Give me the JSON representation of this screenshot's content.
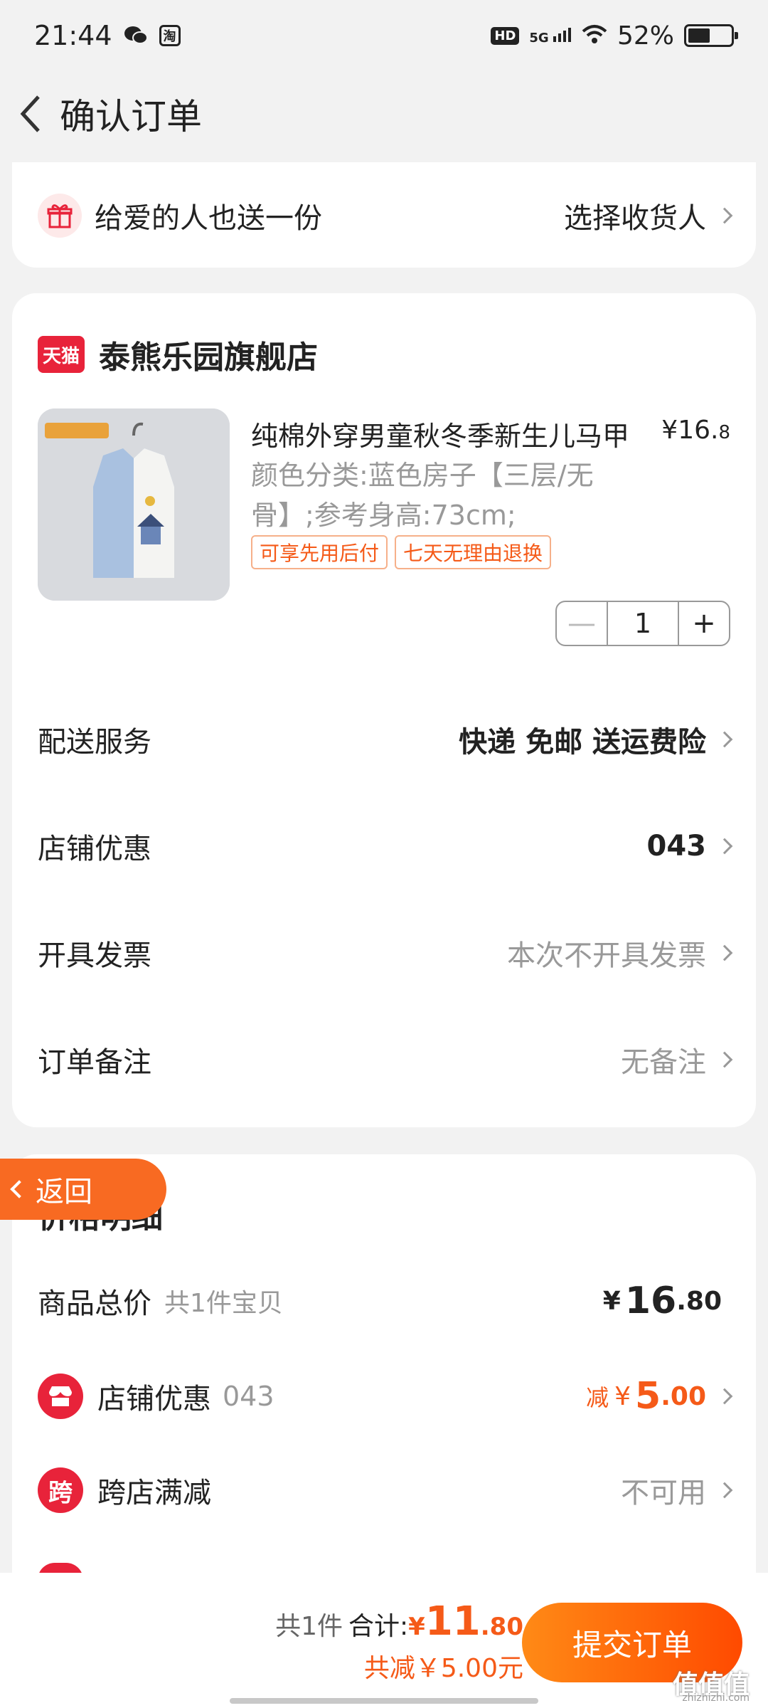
{
  "status": {
    "time": "21:44",
    "battery": "52%",
    "network": "5G",
    "hd": "HD",
    "tao": "淘"
  },
  "header": {
    "title": "确认订单"
  },
  "gift": {
    "label": "给爱的人也送一份",
    "action": "选择收货人"
  },
  "shop": {
    "logo": "天猫",
    "name": "泰熊乐园旗舰店",
    "product": {
      "title": "纯棉外穿男童秋冬季新生儿马甲",
      "price_prefix": "¥16.",
      "price_suffix": "8",
      "sku": "颜色分类:蓝色房子【三层/无骨】;参考身高:73cm;",
      "tags": [
        "可享先用后付",
        "七天无理由退换"
      ],
      "quantity": "1"
    },
    "rows": {
      "delivery": {
        "label": "配送服务",
        "value": "快递 免邮 送运费险"
      },
      "discount": {
        "label": "店铺优惠",
        "value": "043"
      },
      "invoice": {
        "label": "开具发票",
        "value": "本次不开具发票"
      },
      "note": {
        "label": "订单备注",
        "value": "无备注"
      }
    }
  },
  "back_ribbon": {
    "label": "返回"
  },
  "price_detail": {
    "title": "价格明细",
    "total": {
      "label": "商品总价",
      "sub": "共1件宝贝",
      "currency": "¥",
      "int": "16",
      "dec": ".80"
    },
    "shop_discount": {
      "label": "店铺优惠",
      "sub": "043",
      "prefix": "减",
      "currency": "¥",
      "int": "5",
      "dec": ".00"
    },
    "cross_store": {
      "icon": "跨",
      "label": "跨店满减",
      "value": "不可用"
    }
  },
  "bottom": {
    "count": "共1件",
    "sum_label": "合计:",
    "currency": "¥",
    "total_int": "11",
    "total_dec": ".80",
    "saved": "共减￥5.00元",
    "submit": "提交订单"
  },
  "watermark": {
    "main": "值值值",
    "sub": "zhizhizhi.com"
  },
  "colors": {
    "accent": "#f55a18",
    "tmall_red": "#e8233a",
    "button_start": "#ff8a16",
    "button_end": "#ff4a00"
  }
}
